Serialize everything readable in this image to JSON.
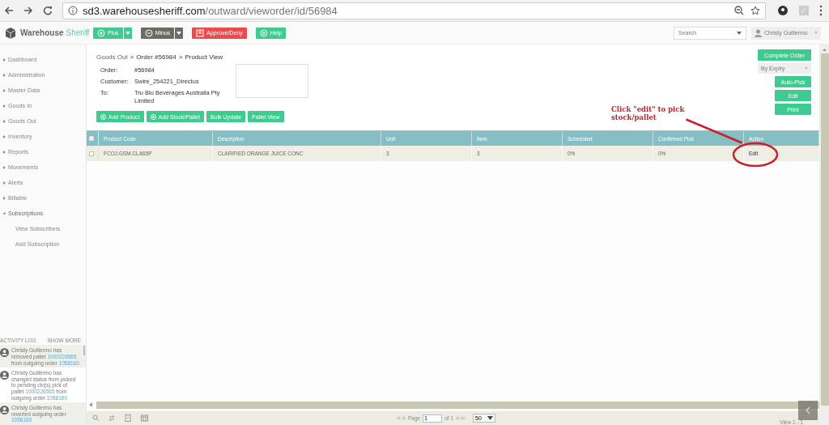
{
  "browser": {
    "url_host": "sd3.warehousesheriff.com",
    "url_path": "/outward/vieworder/id/56984"
  },
  "header": {
    "brand_first": "Warehouse",
    "brand_second": "Sheriff",
    "buttons": [
      {
        "label": "Plus",
        "kind": "green-split"
      },
      {
        "label": "Minus",
        "kind": "grey-split"
      },
      {
        "label": "Approve/Deny",
        "kind": "red"
      },
      {
        "label": "Help",
        "kind": "green"
      }
    ],
    "search": {
      "placeholder": "Search"
    },
    "user": "Christy Guillermo"
  },
  "sidebar": {
    "items": [
      {
        "label": "Dashboard"
      },
      {
        "label": "Administration"
      },
      {
        "label": "Master Data"
      },
      {
        "label": "Goods In"
      },
      {
        "label": "Goods Out"
      },
      {
        "label": "Inventory"
      },
      {
        "label": "Reports"
      },
      {
        "label": "Movements"
      },
      {
        "label": "Alerts"
      },
      {
        "label": "Billable"
      },
      {
        "label": "Subscriptions",
        "expanded": true,
        "children": [
          {
            "label": "View Subscribers"
          },
          {
            "label": "Add Subscription"
          }
        ]
      }
    ]
  },
  "activity_log": {
    "title": "ACTIVITY LOG",
    "show_more": "SHOW MORE",
    "entries": [
      {
        "parts": [
          {
            "text": "Christy Guillermo has removed pallet ",
            "kind": "text"
          },
          {
            "text": "1000226565",
            "kind": "link"
          },
          {
            "text": " from outgoing order ",
            "kind": "text"
          },
          {
            "text": "1058160",
            "kind": "link"
          }
        ]
      },
      {
        "parts": [
          {
            "text": "Christy Guillermo has changed status from picked to pending ctn(s) pick of pallet ",
            "kind": "text"
          },
          {
            "text": "1000226565",
            "kind": "link"
          },
          {
            "text": " from outgoing order ",
            "kind": "text"
          },
          {
            "text": "1058160",
            "kind": "link"
          }
        ]
      },
      {
        "parts": [
          {
            "text": "Christy Guillermo has reverted outgoing order ",
            "kind": "text"
          },
          {
            "text": "1058160",
            "kind": "link"
          }
        ]
      }
    ]
  },
  "breadcrumb": {
    "separator": ">",
    "items": [
      {
        "label": "Goods Out",
        "kind": "link"
      },
      {
        "label": "Order #56984",
        "kind": "text"
      },
      {
        "label": "Product View",
        "kind": "text"
      }
    ]
  },
  "order": {
    "fields": [
      {
        "label": "Order:",
        "value": "#56984"
      },
      {
        "label": "Customer:",
        "value": "Swire_254221_Directus"
      },
      {
        "label": "To:",
        "value": "Tru Blu Beverages Australia Pty Limited"
      }
    ]
  },
  "actions": [
    {
      "label": "Add Product",
      "icon": true
    },
    {
      "label": "Add Stock/Pallet",
      "icon": true
    },
    {
      "label": "Bulk Update",
      "icon": false
    },
    {
      "label": "Pallet View",
      "icon": false
    }
  ],
  "side_actions": {
    "complete": "Complete Order",
    "sort": "By Expiry",
    "buttons": [
      "Auto-Pick",
      "Edit",
      "Print"
    ]
  },
  "table": {
    "all_checked": false,
    "columns": [
      "Product Code",
      "Description",
      "Unit",
      "Item",
      "Scheduled",
      "Confirmed Pick",
      "Action"
    ],
    "rows": [
      {
        "checked": false,
        "cells": [
          "FCOJ.GSM.CLA65P",
          "CLARIFIED ORANGE JUICE CONC",
          "3",
          "3",
          "0%",
          "0%"
        ],
        "action": "Edit"
      }
    ]
  },
  "annotation": {
    "text": "Click \"edit\" to pick stock/pallet"
  },
  "pager": {
    "page_label": "Page",
    "page": "1",
    "of": "of 1",
    "per_page": "50",
    "view": "View 1 - 1"
  }
}
